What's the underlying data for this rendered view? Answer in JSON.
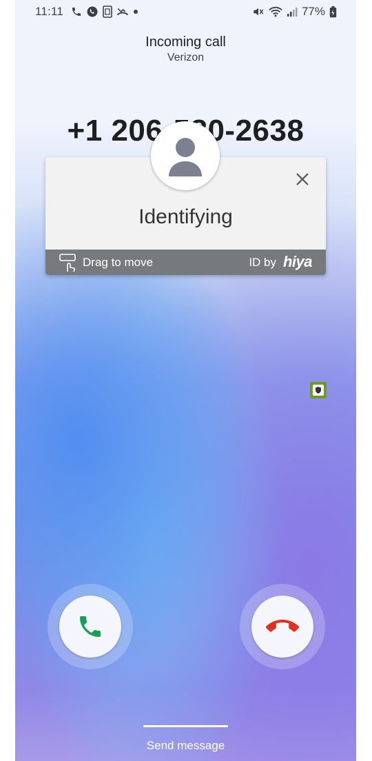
{
  "status_bar": {
    "time": "11:11",
    "battery_percent": "77%",
    "icons_left": [
      "phone-icon",
      "whatsapp-icon",
      "sim-icon",
      "missed-call-icon",
      "dot-icon"
    ],
    "icons_right": [
      "mute-icon",
      "wifi-icon",
      "signal-icon",
      "battery-icon"
    ]
  },
  "call": {
    "type": "Incoming call",
    "carrier": "Verizon",
    "number": "+1 206-580-2638"
  },
  "caller_id_card": {
    "status": "Identifying",
    "drag_label": "Drag to move",
    "id_by": "ID by",
    "brand": "hiya"
  },
  "actions": {
    "answer": "answer-call",
    "decline": "decline-call",
    "send_message": "Send message"
  },
  "colors": {
    "answer_green": "#18a05a",
    "decline_red": "#e0301e",
    "badge_green": "#6e9a2a"
  }
}
